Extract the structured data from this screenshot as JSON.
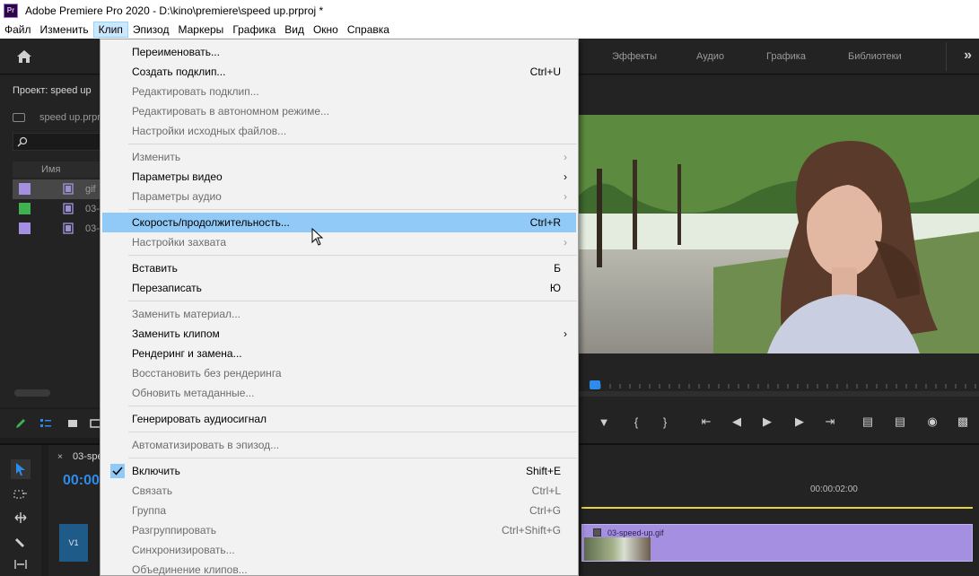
{
  "window": {
    "title": "Adobe Premiere Pro 2020 - D:\\kino\\premiere\\speed up.prproj *",
    "logo_text": "Pr"
  },
  "menubar": {
    "items": [
      {
        "label": "Файл"
      },
      {
        "label": "Изменить"
      },
      {
        "label": "Клип"
      },
      {
        "label": "Эпизод"
      },
      {
        "label": "Маркеры"
      },
      {
        "label": "Графика"
      },
      {
        "label": "Вид"
      },
      {
        "label": "Окно"
      },
      {
        "label": "Справка"
      }
    ],
    "active_index": 2
  },
  "workspaces": {
    "tabs": [
      "Эффекты",
      "Аудио",
      "Графика",
      "Библиотеки"
    ],
    "more": "»"
  },
  "project": {
    "title": "Проект: speed up",
    "file": "speed up.prpr",
    "column_name": "Имя",
    "rows": [
      {
        "label": "gif",
        "color": "#a58fe0",
        "selected": true
      },
      {
        "label": "03-",
        "color": "#3fb24f",
        "selected": false
      },
      {
        "label": "03-",
        "color": "#a58fe0",
        "selected": false
      }
    ]
  },
  "timeline": {
    "tab_close": "×",
    "tab_title": "03-spe",
    "timecode": "00:00",
    "track_label": "V1",
    "ruler_time": "00:00:02:00",
    "clip_name": "03-speed-up.gif",
    "clip_color": "#a58fe0"
  },
  "context_menu": {
    "items": [
      {
        "label": "Переименовать...",
        "shortcut": "",
        "disabled": false
      },
      {
        "label": "Создать подклип...",
        "shortcut": "Ctrl+U",
        "disabled": false
      },
      {
        "label": "Редактировать подклип...",
        "shortcut": "",
        "disabled": true
      },
      {
        "label": "Редактировать в автономном режиме...",
        "shortcut": "",
        "disabled": true
      },
      {
        "label": "Настройки исходных файлов...",
        "shortcut": "",
        "disabled": true
      },
      {
        "label": "Изменить",
        "shortcut": "",
        "disabled": true,
        "submenu": true
      },
      {
        "label": "Параметры видео",
        "shortcut": "",
        "disabled": false,
        "submenu": true
      },
      {
        "label": "Параметры аудио",
        "shortcut": "",
        "disabled": true,
        "submenu": true
      },
      {
        "label": "Скорость/продолжительность...",
        "shortcut": "Ctrl+R",
        "disabled": false,
        "hover": true
      },
      {
        "label": "Настройки захвата",
        "shortcut": "",
        "disabled": true,
        "submenu": true
      },
      {
        "label": "Вставить",
        "shortcut": "Б",
        "disabled": false
      },
      {
        "label": "Перезаписать",
        "shortcut": "Ю",
        "disabled": false
      },
      {
        "label": "Заменить материал...",
        "shortcut": "",
        "disabled": true
      },
      {
        "label": "Заменить клипом",
        "shortcut": "",
        "disabled": false,
        "submenu": true
      },
      {
        "label": "Рендеринг и замена...",
        "shortcut": "",
        "disabled": false
      },
      {
        "label": "Восстановить без рендеринга",
        "shortcut": "",
        "disabled": true
      },
      {
        "label": "Обновить метаданные...",
        "shortcut": "",
        "disabled": true
      },
      {
        "label": "Генерировать аудиосигнал",
        "shortcut": "",
        "disabled": false
      },
      {
        "label": "Автоматизировать в эпизод...",
        "shortcut": "",
        "disabled": true
      },
      {
        "label": "Включить",
        "shortcut": "Shift+E",
        "disabled": false,
        "checked": true
      },
      {
        "label": "Связать",
        "shortcut": "Ctrl+L",
        "disabled": true
      },
      {
        "label": "Группа",
        "shortcut": "Ctrl+G",
        "disabled": true
      },
      {
        "label": "Разгруппировать",
        "shortcut": "Ctrl+Shift+G",
        "disabled": true
      },
      {
        "label": "Синхронизировать...",
        "shortcut": "",
        "disabled": true
      },
      {
        "label": "Объединение клипов...",
        "shortcut": "",
        "disabled": true
      }
    ]
  }
}
